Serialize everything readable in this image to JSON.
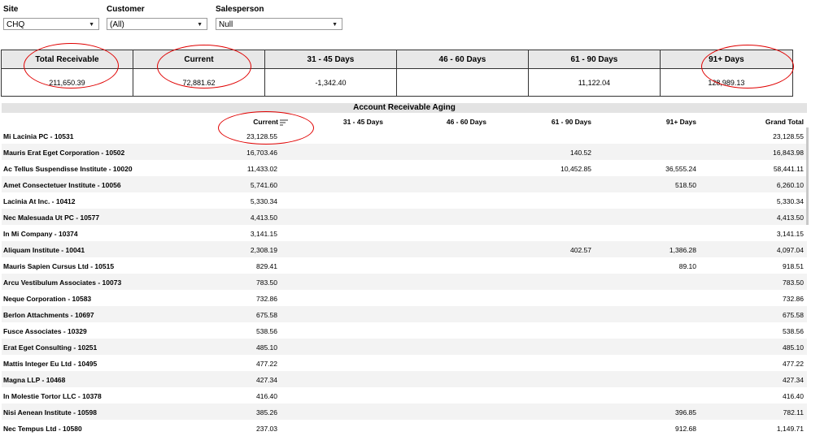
{
  "filters": [
    {
      "label": "Site",
      "value": "CHQ"
    },
    {
      "label": "Customer",
      "value": "(All)"
    },
    {
      "label": "Salesperson",
      "value": "Null"
    }
  ],
  "summary": {
    "headers": [
      "Total Receivable",
      "Current",
      "31 - 45 Days",
      "46 - 60 Days",
      "61 - 90 Days",
      "91+ Days"
    ],
    "values": [
      "211,650.39",
      "72,881.62",
      "-1,342.40",
      "",
      "11,122.04",
      "128,989.13"
    ]
  },
  "aging": {
    "title": "Account Receivable Aging",
    "columns": [
      "Current",
      "31 - 45 Days",
      "46 - 60 Days",
      "61 - 90 Days",
      "91+ Days",
      "Grand Total"
    ],
    "rows": [
      {
        "name": "Mi Lacinia PC - 10531",
        "current": "23,128.55",
        "d31": "",
        "d46": "",
        "d61": "",
        "d91": "",
        "total": "23,128.55"
      },
      {
        "name": "Mauris Erat Eget Corporation - 10502",
        "current": "16,703.46",
        "d31": "",
        "d46": "",
        "d61": "140.52",
        "d91": "",
        "total": "16,843.98"
      },
      {
        "name": "Ac Tellus Suspendisse Institute - 10020",
        "current": "11,433.02",
        "d31": "",
        "d46": "",
        "d61": "10,452.85",
        "d91": "36,555.24",
        "total": "58,441.11"
      },
      {
        "name": "Amet Consectetuer Institute - 10056",
        "current": "5,741.60",
        "d31": "",
        "d46": "",
        "d61": "",
        "d91": "518.50",
        "total": "6,260.10"
      },
      {
        "name": "Lacinia At Inc. - 10412",
        "current": "5,330.34",
        "d31": "",
        "d46": "",
        "d61": "",
        "d91": "",
        "total": "5,330.34"
      },
      {
        "name": "Nec Malesuada Ut PC - 10577",
        "current": "4,413.50",
        "d31": "",
        "d46": "",
        "d61": "",
        "d91": "",
        "total": "4,413.50"
      },
      {
        "name": "In Mi Company - 10374",
        "current": "3,141.15",
        "d31": "",
        "d46": "",
        "d61": "",
        "d91": "",
        "total": "3,141.15"
      },
      {
        "name": "Aliquam Institute - 10041",
        "current": "2,308.19",
        "d31": "",
        "d46": "",
        "d61": "402.57",
        "d91": "1,386.28",
        "total": "4,097.04"
      },
      {
        "name": "Mauris Sapien Cursus Ltd - 10515",
        "current": "829.41",
        "d31": "",
        "d46": "",
        "d61": "",
        "d91": "89.10",
        "total": "918.51"
      },
      {
        "name": "Arcu Vestibulum Associates - 10073",
        "current": "783.50",
        "d31": "",
        "d46": "",
        "d61": "",
        "d91": "",
        "total": "783.50"
      },
      {
        "name": "Neque Corporation - 10583",
        "current": "732.86",
        "d31": "",
        "d46": "",
        "d61": "",
        "d91": "",
        "total": "732.86"
      },
      {
        "name": "Berlon Attachments - 10697",
        "current": "675.58",
        "d31": "",
        "d46": "",
        "d61": "",
        "d91": "",
        "total": "675.58"
      },
      {
        "name": "Fusce Associates - 10329",
        "current": "538.56",
        "d31": "",
        "d46": "",
        "d61": "",
        "d91": "",
        "total": "538.56"
      },
      {
        "name": "Erat Eget Consulting - 10251",
        "current": "485.10",
        "d31": "",
        "d46": "",
        "d61": "",
        "d91": "",
        "total": "485.10"
      },
      {
        "name": "Mattis Integer Eu Ltd - 10495",
        "current": "477.22",
        "d31": "",
        "d46": "",
        "d61": "",
        "d91": "",
        "total": "477.22"
      },
      {
        "name": "Magna LLP - 10468",
        "current": "427.34",
        "d31": "",
        "d46": "",
        "d61": "",
        "d91": "",
        "total": "427.34"
      },
      {
        "name": "In Molestie Tortor LLC - 10378",
        "current": "416.40",
        "d31": "",
        "d46": "",
        "d61": "",
        "d91": "",
        "total": "416.40"
      },
      {
        "name": "Nisi Aenean Institute - 10598",
        "current": "385.26",
        "d31": "",
        "d46": "",
        "d61": "",
        "d91": "396.85",
        "total": "782.11"
      },
      {
        "name": "Nec Tempus Ltd - 10580",
        "current": "237.03",
        "d31": "",
        "d46": "",
        "d61": "",
        "d91": "912.68",
        "total": "1,149.71"
      }
    ]
  },
  "icons": {
    "dropdown": "chevron-down-icon",
    "sort": "sort-descending-icon"
  },
  "annotation_color": "#e00000"
}
